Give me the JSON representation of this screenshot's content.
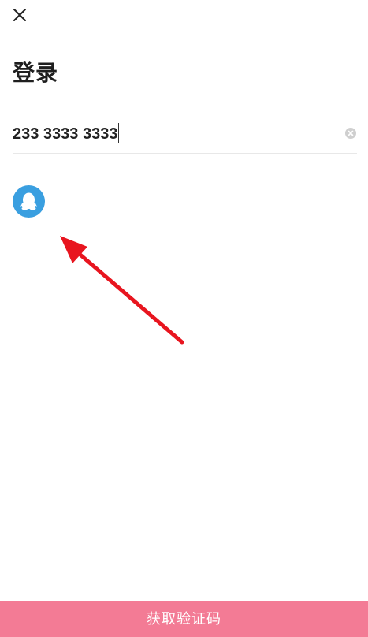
{
  "header": {
    "close_icon": "close-icon"
  },
  "page": {
    "title": "登录"
  },
  "phone_field": {
    "value": "233 3333 3333",
    "clear_icon": "clear-icon"
  },
  "third_party_login": {
    "qq_icon": "qq-penguin-icon",
    "qq_color": "#3a9fe0"
  },
  "annotation": {
    "arrow_color": "#e8151f"
  },
  "footer": {
    "submit_label": "获取验证码",
    "submit_color": "#f37b95"
  }
}
